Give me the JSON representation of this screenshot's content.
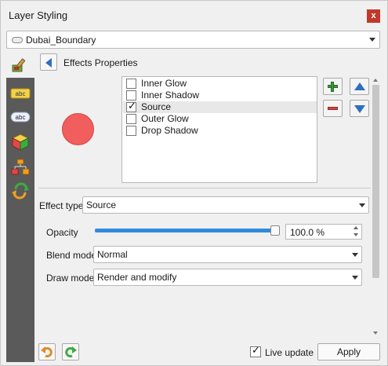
{
  "window": {
    "title": "Layer Styling",
    "close_glyph": "x"
  },
  "layer": {
    "name": "Dubai_Boundary"
  },
  "effects": {
    "header": "Effects Properties",
    "items": [
      {
        "label": "Inner Glow",
        "checked": false,
        "selected": false
      },
      {
        "label": "Inner Shadow",
        "checked": false,
        "selected": false
      },
      {
        "label": "Source",
        "checked": true,
        "selected": true
      },
      {
        "label": "Outer Glow",
        "checked": false,
        "selected": false
      },
      {
        "label": "Drop Shadow",
        "checked": false,
        "selected": false
      }
    ],
    "check_glyph": "✓"
  },
  "effect_type": {
    "label": "Effect type",
    "value": "Source"
  },
  "opacity": {
    "label": "Opacity",
    "value": "100.0 %",
    "level": 1.0
  },
  "blend_mode": {
    "label": "Blend mode",
    "value": "Normal"
  },
  "draw_mode": {
    "label": "Draw mode",
    "value": "Render and modify"
  },
  "footer": {
    "live_update_label": "Live update",
    "live_update_checked": true,
    "apply_label": "Apply"
  },
  "colors": {
    "preview_fill": "#f25d5d",
    "sidebar_bg": "#5a5a5a",
    "slider_fill": "#2f8be0",
    "accent_blue": "#2f6fbf"
  }
}
